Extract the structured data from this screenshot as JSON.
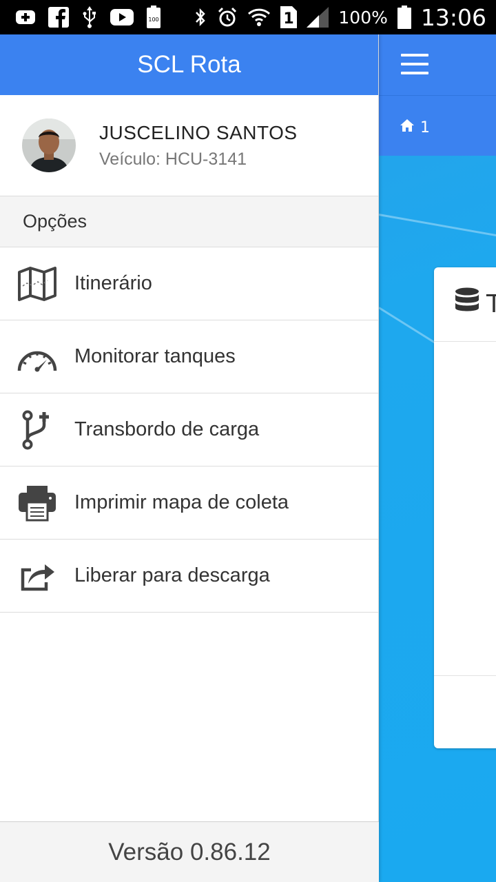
{
  "status_bar": {
    "battery_percent": "100%",
    "time": "13:06",
    "sim_slot": "1",
    "battery_level_label": "100",
    "icons": [
      "add-box-icon",
      "facebook-icon",
      "usb-icon",
      "youtube-icon",
      "battery-saver-icon",
      "bluetooth-icon",
      "alarm-icon",
      "wifi-icon",
      "sim-icon",
      "signal-icon",
      "battery-icon"
    ]
  },
  "app": {
    "title": "SCL Rota"
  },
  "background": {
    "breadcrumb_number": "1",
    "card_title_initial": "T",
    "colors": {
      "header": "#3b82f0",
      "background": "#1ea8ee"
    }
  },
  "profile": {
    "name": "JUSCELINO SANTOS",
    "vehicle": "Veículo: HCU-3141"
  },
  "menu": {
    "section_title": "Opções",
    "items": [
      {
        "label": "Itinerário",
        "icon": "map-icon"
      },
      {
        "label": "Monitorar tanques",
        "icon": "gauge-icon"
      },
      {
        "label": "Transbordo de carga",
        "icon": "branch-plus-icon"
      },
      {
        "label": "Imprimir mapa de coleta",
        "icon": "printer-icon"
      },
      {
        "label": "Liberar para descarga",
        "icon": "share-icon"
      }
    ]
  },
  "footer": {
    "version": "Versão 0.86.12"
  }
}
